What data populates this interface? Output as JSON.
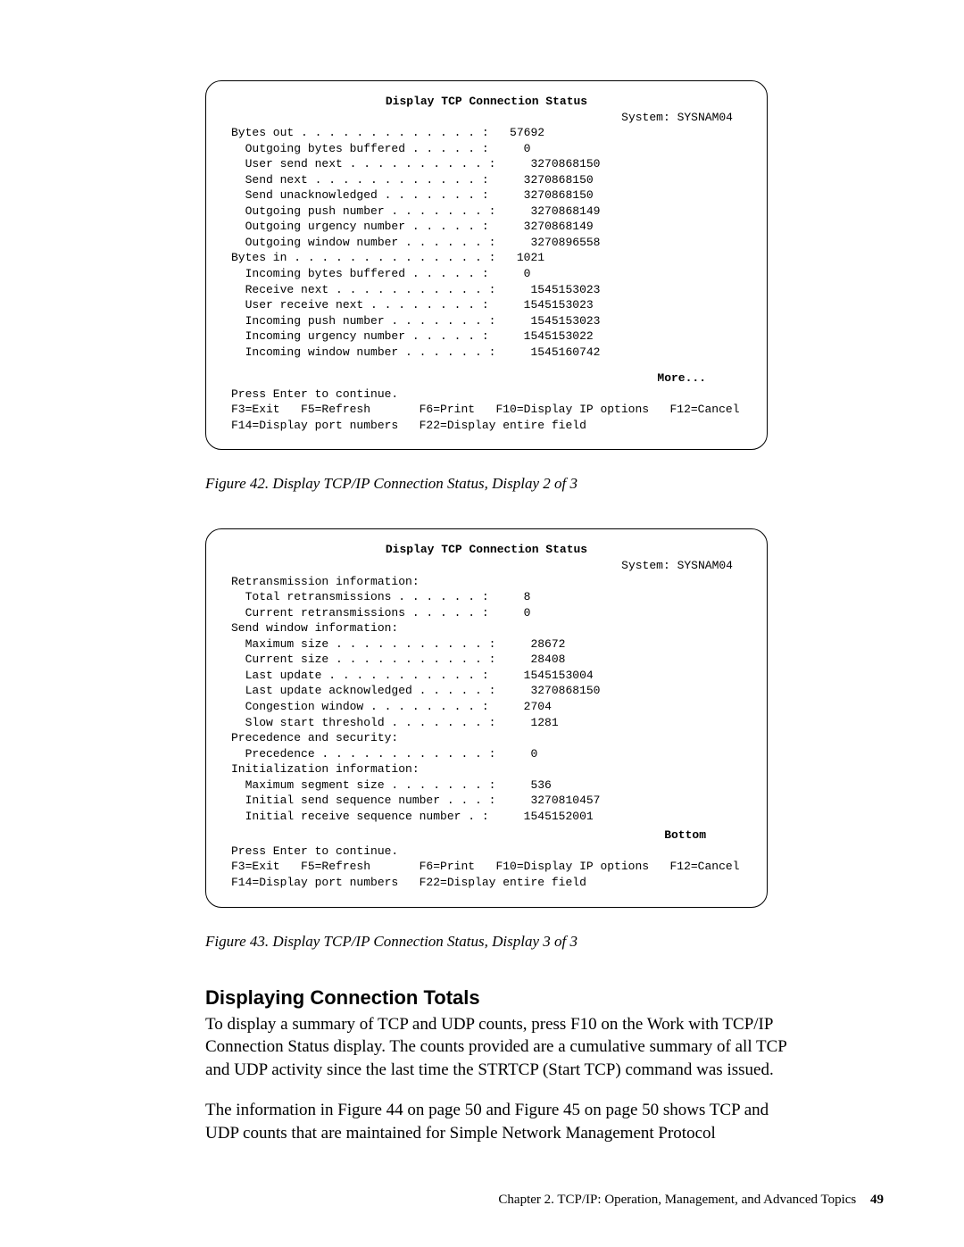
{
  "screen1": {
    "title": "Display TCP Connection Status",
    "system_label": "System:",
    "system_value": "SYSNAM04",
    "rows": [
      {
        "indent": 0,
        "label": "Bytes out",
        "value": "57692"
      },
      {
        "indent": 1,
        "label": "Outgoing bytes buffered",
        "value": "0"
      },
      {
        "indent": 1,
        "label": "User send next",
        "value": "3270868150"
      },
      {
        "indent": 1,
        "label": "Send next",
        "value": "3270868150"
      },
      {
        "indent": 1,
        "label": "Send unacknowledged",
        "value": "3270868150"
      },
      {
        "indent": 1,
        "label": "Outgoing push number",
        "value": "3270868149"
      },
      {
        "indent": 1,
        "label": "Outgoing urgency number",
        "value": "3270868149"
      },
      {
        "indent": 1,
        "label": "Outgoing window number",
        "value": "3270896558"
      },
      {
        "indent": 0,
        "label": "Bytes in",
        "value": "1021"
      },
      {
        "indent": 1,
        "label": "Incoming bytes buffered",
        "value": "0"
      },
      {
        "indent": 1,
        "label": "Receive next",
        "value": "1545153023"
      },
      {
        "indent": 1,
        "label": "User receive next",
        "value": "1545153023"
      },
      {
        "indent": 1,
        "label": "Incoming push number",
        "value": "1545153023"
      },
      {
        "indent": 1,
        "label": "Incoming urgency number",
        "value": "1545153022"
      },
      {
        "indent": 1,
        "label": "Incoming window number",
        "value": "1545160742"
      }
    ],
    "more": "More...",
    "press_enter": "Press Enter to continue.",
    "fkeys1": "F3=Exit   F5=Refresh       F6=Print   F10=Display IP options   F12=Cancel",
    "fkeys2": "F14=Display port numbers   F22=Display entire field"
  },
  "caption1": "Figure 42. Display TCP/IP Connection Status, Display 2 of 3",
  "screen2": {
    "title": "Display TCP Connection Status",
    "system_label": "System:",
    "system_value": "SYSNAM04",
    "lines": [
      {
        "type": "header",
        "text": "Retransmission information:"
      },
      {
        "type": "kv",
        "indent": 1,
        "label": "Total retransmissions",
        "value": "8"
      },
      {
        "type": "kv",
        "indent": 1,
        "label": "Current retransmissions",
        "value": "0"
      },
      {
        "type": "header",
        "text": "Send window information:"
      },
      {
        "type": "kv",
        "indent": 1,
        "label": "Maximum size",
        "value": "28672"
      },
      {
        "type": "kv",
        "indent": 1,
        "label": "Current size",
        "value": "28408"
      },
      {
        "type": "kv",
        "indent": 1,
        "label": "Last update",
        "value": "1545153004"
      },
      {
        "type": "kv",
        "indent": 1,
        "label": "Last update acknowledged",
        "value": "3270868150"
      },
      {
        "type": "kv",
        "indent": 1,
        "label": "Congestion window",
        "value": "2704"
      },
      {
        "type": "kv",
        "indent": 1,
        "label": "Slow start threshold",
        "value": "1281"
      },
      {
        "type": "header",
        "text": "Precedence and security:"
      },
      {
        "type": "kv",
        "indent": 1,
        "label": "Precedence",
        "value": "0"
      },
      {
        "type": "header",
        "text": "Initialization information:"
      },
      {
        "type": "kv",
        "indent": 1,
        "label": "Maximum segment size",
        "value": "536"
      },
      {
        "type": "kv",
        "indent": 1,
        "label": "Initial send sequence number",
        "value": "3270810457"
      },
      {
        "type": "kv",
        "indent": 1,
        "label": "Initial receive sequence number",
        "value": "1545152001"
      }
    ],
    "bottom": "Bottom",
    "press_enter": "Press Enter to continue.",
    "fkeys1": "F3=Exit   F5=Refresh       F6=Print   F10=Display IP options   F12=Cancel",
    "fkeys2": "F14=Display port numbers   F22=Display entire field"
  },
  "caption2": "Figure 43. Display TCP/IP Connection Status, Display 3 of 3",
  "heading": "Displaying Connection Totals",
  "para1": "To display a summary of TCP and UDP counts, press F10 on the Work with TCP/IP Connection Status display. The counts provided are a cumulative summary of all TCP and UDP activity since the last time the STRTCP (Start TCP) command was issued.",
  "para2": "The information in Figure 44 on page 50 and Figure 45 on page 50 shows TCP and UDP counts that are maintained for Simple Network Management Protocol",
  "footer_text": "Chapter 2. TCP/IP: Operation, Management, and Advanced Topics",
  "footer_page": "49"
}
